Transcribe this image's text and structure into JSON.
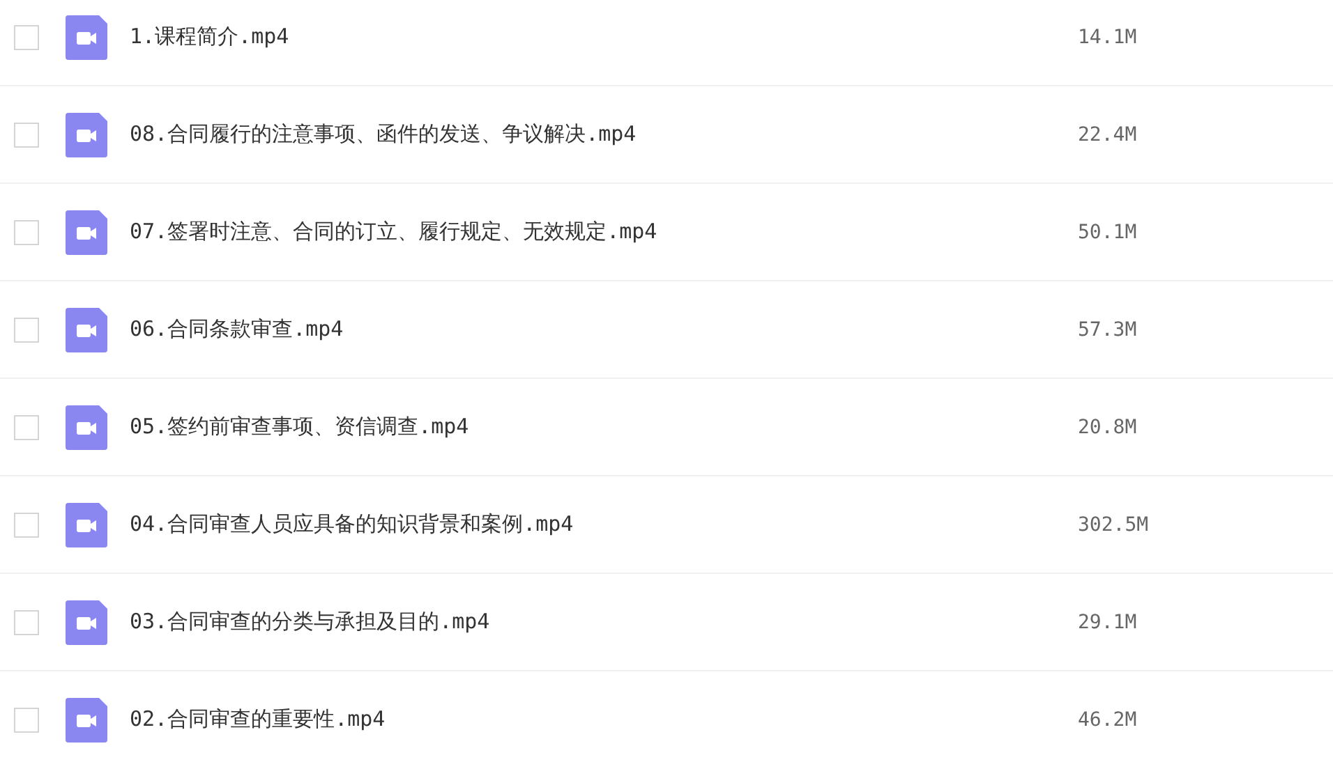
{
  "files": [
    {
      "name": "1.课程简介.mp4",
      "size": "14.1M",
      "checked": false
    },
    {
      "name": "08.合同履行的注意事项、函件的发送、争议解决.mp4",
      "size": "22.4M",
      "checked": false
    },
    {
      "name": "07.签署时注意、合同的订立、履行规定、无效规定.mp4",
      "size": "50.1M",
      "checked": false
    },
    {
      "name": "06.合同条款审查.mp4",
      "size": "57.3M",
      "checked": false
    },
    {
      "name": "05.签约前审查事项、资信调查.mp4",
      "size": "20.8M",
      "checked": false
    },
    {
      "name": "04.合同审查人员应具备的知识背景和案例.mp4",
      "size": "302.5M",
      "checked": false
    },
    {
      "name": "03.合同审查的分类与承担及目的.mp4",
      "size": "29.1M",
      "checked": false
    },
    {
      "name": "02.合同审查的重要性.mp4",
      "size": "46.2M",
      "checked": false
    }
  ]
}
